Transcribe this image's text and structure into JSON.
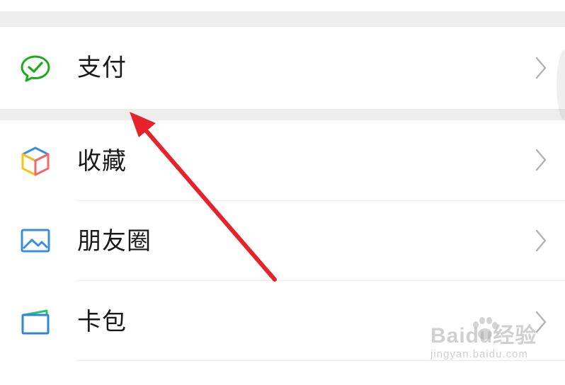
{
  "menu": {
    "items": [
      {
        "label": "支付",
        "icon": "wechat-pay-icon"
      },
      {
        "label": "收藏",
        "icon": "favorites-cube-icon"
      },
      {
        "label": "朋友圈",
        "icon": "moments-photo-icon"
      },
      {
        "label": "卡包",
        "icon": "card-wallet-icon"
      }
    ]
  },
  "watermark": {
    "main": "Baidu经验",
    "sub": "jingyan.baidu.com"
  },
  "colors": {
    "pay_green": "#1aad19",
    "arrow_red": "#e8222a",
    "moments_blue": "#3b8de0",
    "cards_blue": "#2f86d9",
    "cards_green": "#28c76f"
  }
}
